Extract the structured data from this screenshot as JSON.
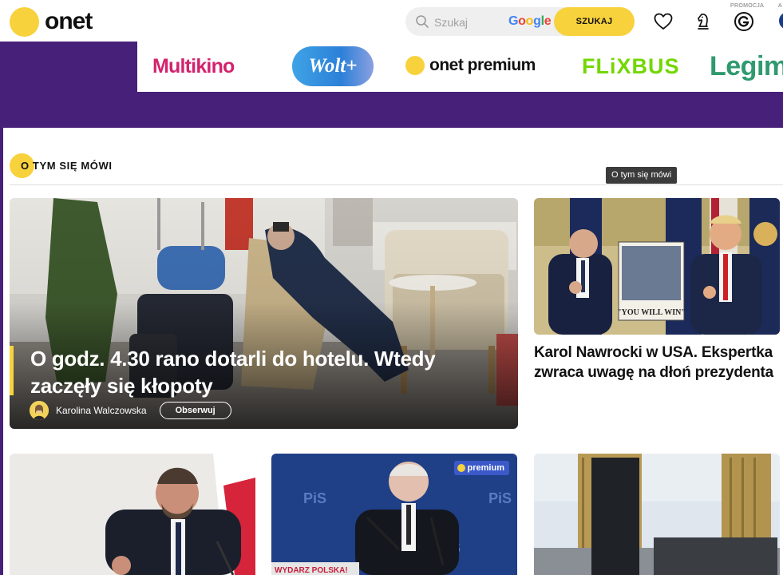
{
  "header": {
    "logo_text": "onet",
    "search_placeholder": "Szukaj",
    "search_provider": "Google",
    "search_button": "SZUKAJ",
    "promo_label": "PROMOCJA",
    "promo_label_2": "A"
  },
  "partners": [
    "Multikino",
    "Wolt+",
    "onet premium",
    "FLiXBUS",
    "Legim"
  ],
  "section": {
    "title": "O TYM SIĘ MÓWI",
    "tooltip": "O tym się mówi"
  },
  "main_article": {
    "headline": "O godz. 4.30 rano dotarli do hotelu. Wtedy zaczęły się kłopoty",
    "author": "Karolina Walczowska",
    "follow_label": "Obserwuj"
  },
  "side_article": {
    "headline": "Karol Nawrocki w USA. Ekspertka zwraca uwagę na dłoń prezydenta",
    "image_caption_text": "\"YOU WILL WIN\""
  },
  "bottom_cards": [
    {
      "badge": ""
    },
    {
      "badge": "premium",
      "sign_text": "WYDARZ POLSKA!",
      "logo_text": "PiS"
    },
    {
      "badge": ""
    }
  ],
  "colors": {
    "brand_yellow": "#f7d23c",
    "band_purple": "#47207a",
    "premium_blue": "#3b59c9"
  },
  "icons": [
    "search-icon",
    "heart-icon",
    "chess-knight-icon",
    "g-circle-icon",
    "user-avatar-icon"
  ]
}
